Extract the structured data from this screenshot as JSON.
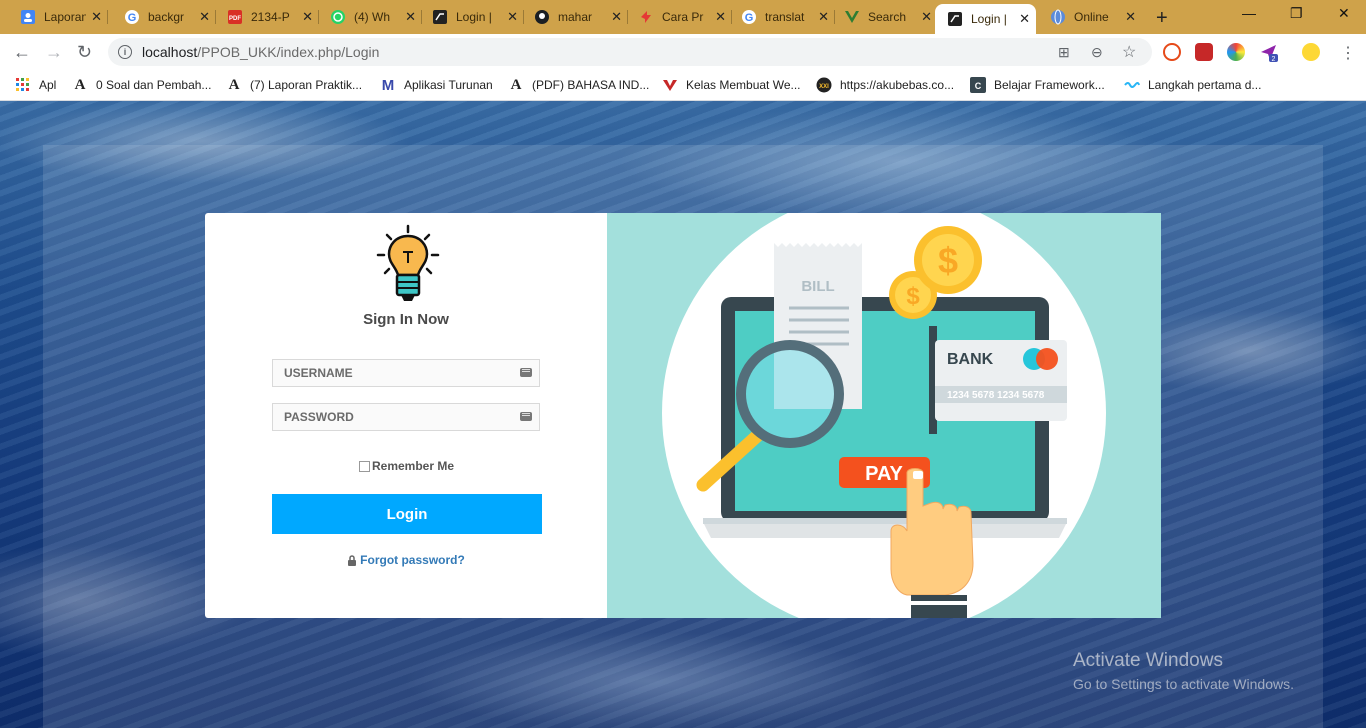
{
  "browser": {
    "tabs": [
      {
        "title": "Laporan",
        "icon": "contact-icon"
      },
      {
        "title": "backgr",
        "icon": "google-icon"
      },
      {
        "title": "2134-P",
        "icon": "pdf-icon"
      },
      {
        "title": "(4) Wh",
        "icon": "whatsapp-icon"
      },
      {
        "title": "Login |",
        "icon": "app-logo-icon"
      },
      {
        "title": "mahar",
        "icon": "github-icon"
      },
      {
        "title": "Cara Pr",
        "icon": "red-arrow-icon"
      },
      {
        "title": "translat",
        "icon": "google-icon"
      },
      {
        "title": "Search",
        "icon": "vue-icon"
      },
      {
        "title": "Login |",
        "icon": "app-logo-icon",
        "active": true
      },
      {
        "title": "Online",
        "icon": "globe-icon"
      }
    ],
    "new_tab": "+",
    "window_controls": {
      "minimize": "—",
      "restore": "❐",
      "close": "✕"
    },
    "url_host": "localhost",
    "url_path": "/PPOB_UKK/index.php/Login",
    "bookmarks": [
      {
        "label": "Apl",
        "icon": "apps-grid-icon"
      },
      {
        "label": "0 Soal dan Pembah...",
        "icon": "academia-icon"
      },
      {
        "label": "(7) Laporan Praktik...",
        "icon": "academia-icon"
      },
      {
        "label": "Aplikasi Turunan",
        "icon": "m-logo-icon"
      },
      {
        "label": "(PDF) BAHASA IND...",
        "icon": "academia-icon"
      },
      {
        "label": "Kelas Membuat We...",
        "icon": "red-logo-icon"
      },
      {
        "label": "https://akubebas.co...",
        "icon": "xxi-icon"
      },
      {
        "label": "Belajar Framework...",
        "icon": "ci-icon"
      },
      {
        "label": "Langkah pertama d...",
        "icon": "wave-icon"
      }
    ]
  },
  "login": {
    "title": "Sign In Now",
    "username_placeholder": "USERNAME",
    "password_placeholder": "PASSWORD",
    "remember_label": "Remember Me",
    "login_button": "Login",
    "forgot_link": "Forgot password?"
  },
  "illustration": {
    "bill_label": "BILL",
    "bank_label": "BANK",
    "card_number": "1234 5678 1234 5678",
    "pay_label": "PAY",
    "coin_symbol": "$"
  },
  "watermark": {
    "line1": "Activate Windows",
    "line2": "Go to Settings to activate Windows."
  },
  "colors": {
    "tabstrip": "#cfa24a",
    "login_button": "#00a8ff",
    "illustration_bg": "#a3e0dc",
    "link": "#337ab7"
  }
}
